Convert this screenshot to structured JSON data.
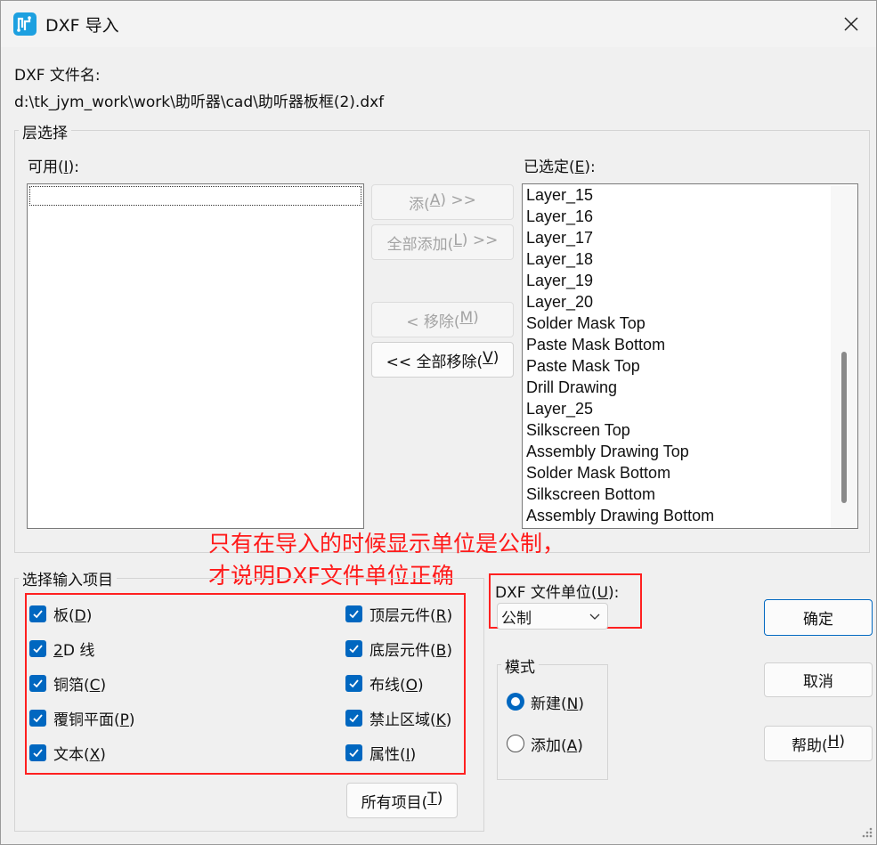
{
  "window": {
    "title": "DXF 导入"
  },
  "file": {
    "label": "DXF 文件名:",
    "path": "d:\\tk_jym_work\\work\\助听器\\cad\\助听器板框(2).dxf"
  },
  "layer_select": {
    "title": "层选择",
    "available_label_pre": "可用(",
    "available_label_key": "I",
    "available_label_post": "):",
    "selected_label_pre": "已选定(",
    "selected_label_key": "E",
    "selected_label_post": "):",
    "available_items": [],
    "selected_items": [
      "Layer_15",
      "Layer_16",
      "Layer_17",
      "Layer_18",
      "Layer_19",
      "Layer_20",
      "Solder Mask Top",
      "Paste Mask Bottom",
      "Paste Mask Top",
      "Drill Drawing",
      "Layer_25",
      "Silkscreen Top",
      "Assembly Drawing Top",
      "Solder Mask Bottom",
      "Silkscreen Bottom",
      "Assembly Drawing Bottom"
    ],
    "buttons": {
      "add_pre": "添(",
      "add_key": "A",
      "add_post": ") >>",
      "add_all_pre": "全部添加(",
      "add_all_key": "L",
      "add_all_post": ") >>",
      "remove_pre": "< 移除(",
      "remove_key": "M",
      "remove_post": ")",
      "remove_all_pre": "<< 全部移除(",
      "remove_all_key": "V",
      "remove_all_post": ")"
    }
  },
  "annotation": {
    "line1": "只有在导入的时候显示单位是公制，",
    "line2": "才说明DXF文件单位正确",
    "color": "#ff1a1a"
  },
  "import_items": {
    "title": "选择输入项目",
    "items": [
      {
        "pre": "板(",
        "key": "D",
        "post": ")",
        "checked": true
      },
      {
        "pre": "顶层元件(",
        "key": "R",
        "post": ")",
        "checked": true
      },
      {
        "pre": "",
        "key": "2",
        "post": "D 线",
        "checked": true
      },
      {
        "pre": "底层元件(",
        "key": "B",
        "post": ")",
        "checked": true
      },
      {
        "pre": "铜箔(",
        "key": "C",
        "post": ")",
        "checked": true
      },
      {
        "pre": "布线(",
        "key": "O",
        "post": ")",
        "checked": true
      },
      {
        "pre": "覆铜平面(",
        "key": "P",
        "post": ")",
        "checked": true
      },
      {
        "pre": "禁止区域(",
        "key": "K",
        "post": ")",
        "checked": true
      },
      {
        "pre": "文本(",
        "key": "X",
        "post": ")",
        "checked": true
      },
      {
        "pre": "属性(",
        "key": "I",
        "post": ")",
        "checked": true
      }
    ],
    "all_button_pre": "所有项目(",
    "all_button_key": "T",
    "all_button_post": ")"
  },
  "units": {
    "label_pre": "DXF 文件单位(",
    "label_key": "U",
    "label_post": "):",
    "selected": "公制"
  },
  "mode": {
    "title": "模式",
    "new_pre": "新建(",
    "new_key": "N",
    "new_post": ")",
    "add_pre": "添加(",
    "add_key": "A",
    "add_post": ")",
    "selected": "new"
  },
  "actions": {
    "ok": "确定",
    "cancel": "取消",
    "help_pre": "帮助(",
    "help_key": "H",
    "help_post": ")"
  },
  "colors": {
    "accent": "#0067c0",
    "annotation": "#ff1a1a"
  }
}
